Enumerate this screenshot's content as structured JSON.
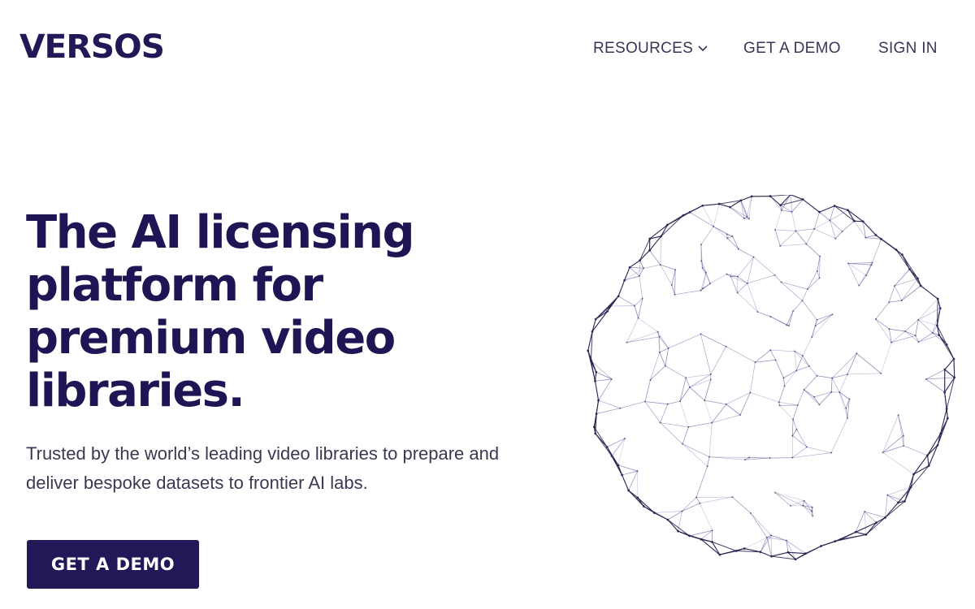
{
  "brand": {
    "logo_text": "VERSOS",
    "color": "#211858"
  },
  "nav": {
    "resources_label": "RESOURCES",
    "demo_label": "GET A DEMO",
    "signin_label": "SIGN IN"
  },
  "hero": {
    "title": "The AI licensing platform for premium video libraries.",
    "subtitle": "Trusted by the world’s leading video libraries to prepare and deliver bespoke datasets to frontier AI labs.",
    "cta_label": "GET A DEMO"
  },
  "icons": {
    "resources_chevron": "chevron-down-icon",
    "globe": "network-globe-image"
  },
  "colors": {
    "primary": "#211858",
    "text": "#3b3950",
    "background": "#ffffff"
  }
}
